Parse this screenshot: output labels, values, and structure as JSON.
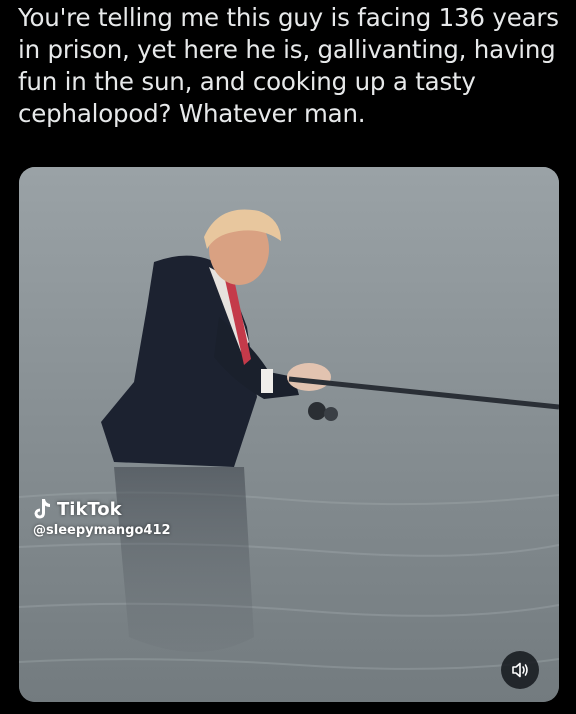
{
  "post": {
    "text": "You're telling me this guy is facing 136 years in prison, yet here he is, gallivanting, having fun in the sun, and cooking up a tasty cephalopod? Whatever man."
  },
  "media": {
    "watermark": {
      "brand": "TikTok",
      "handle": "@sleepymango412"
    },
    "controls": {
      "mute_icon": "speaker-muted-icon"
    }
  }
}
